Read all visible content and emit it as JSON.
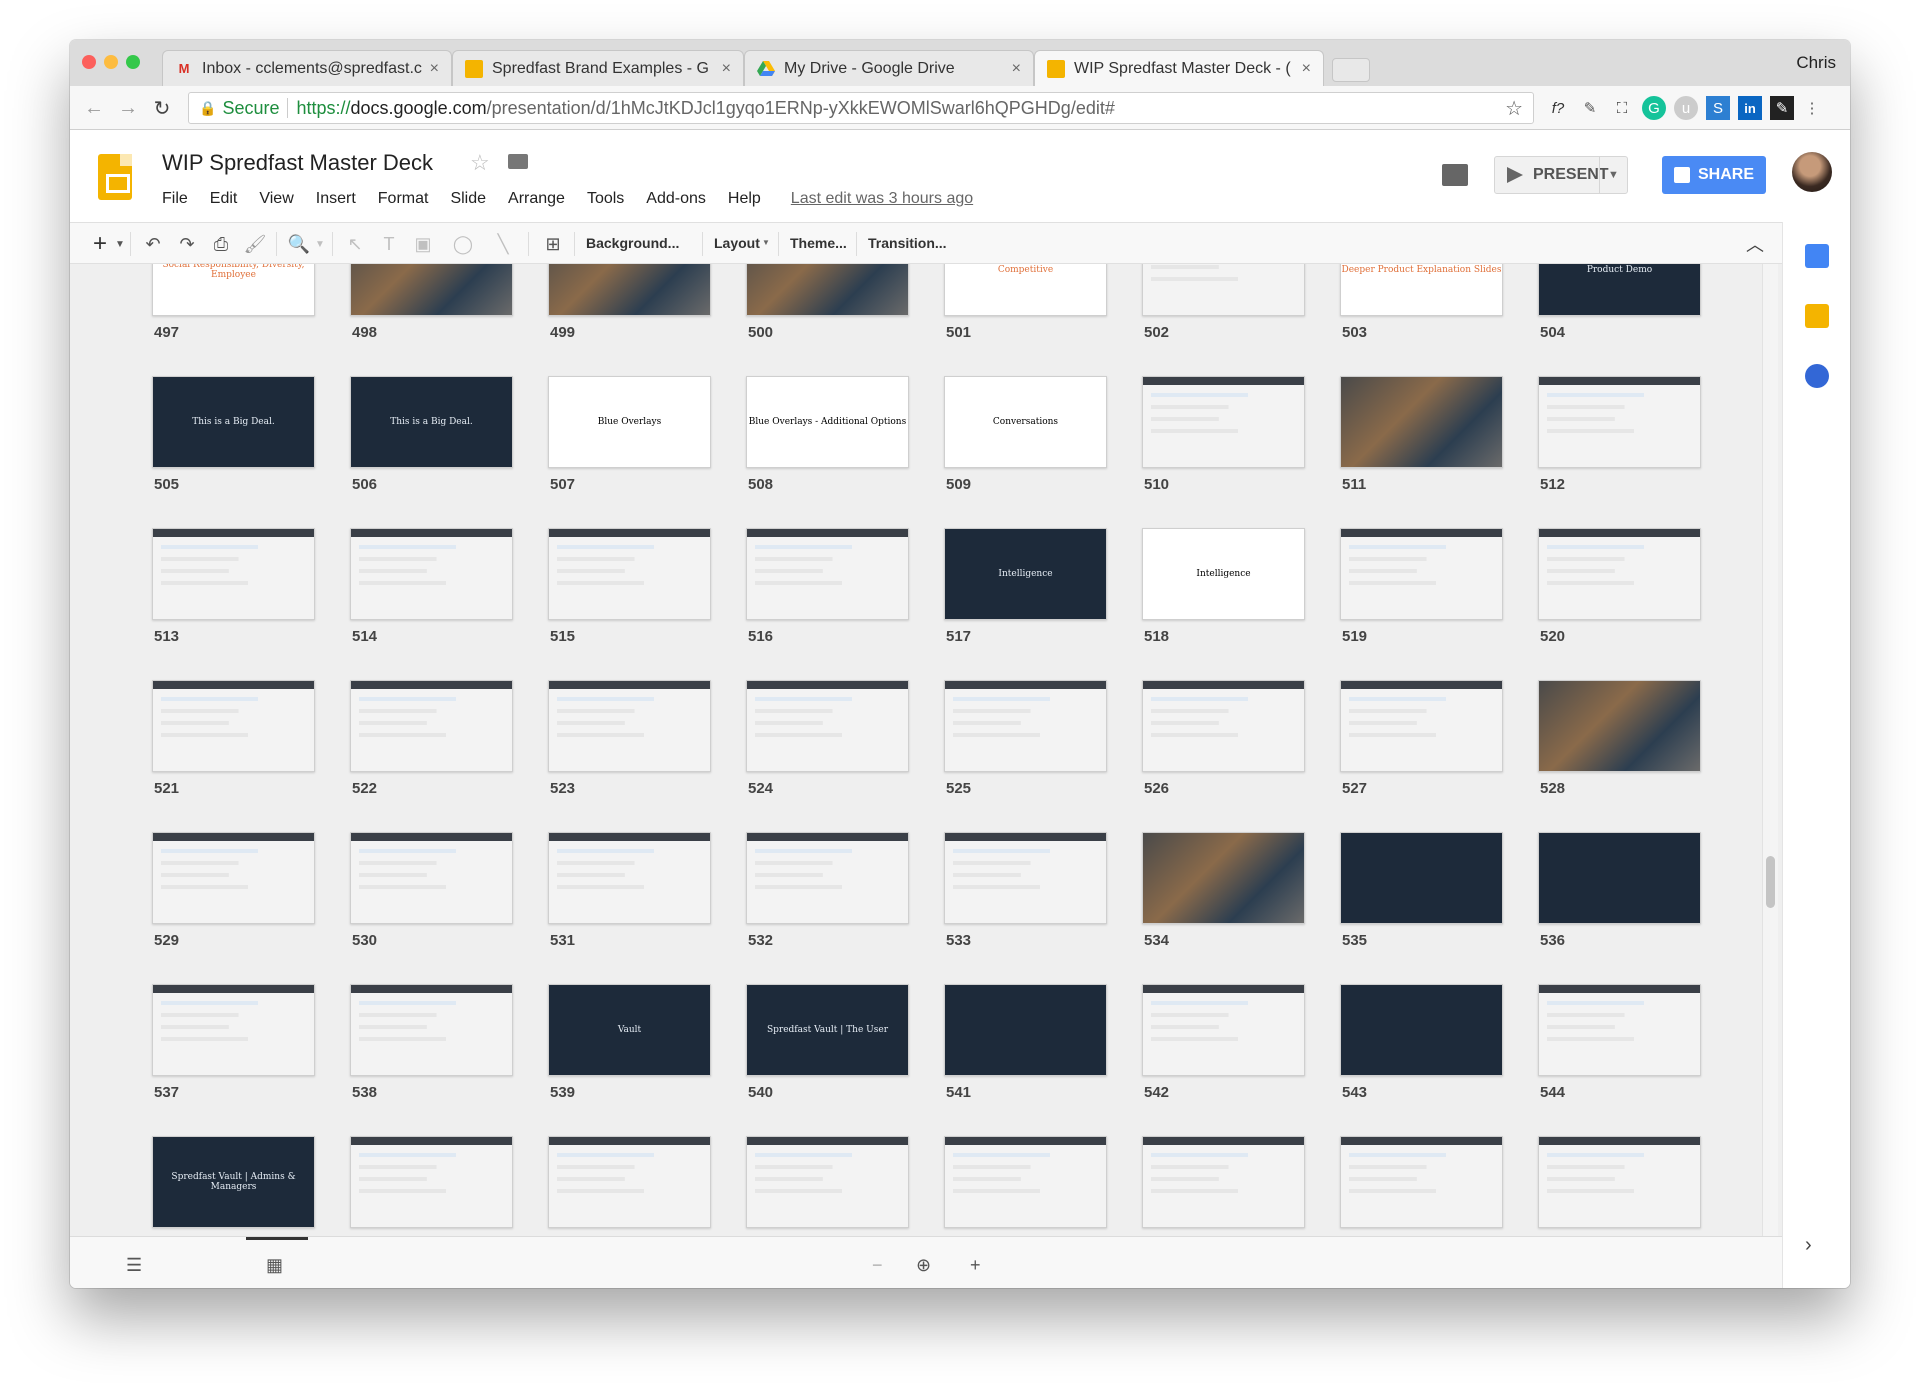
{
  "browser": {
    "profile_name": "Chris",
    "tabs": [
      {
        "label": "Inbox - cclements@spredfast.c",
        "icon": "gmail-icon"
      },
      {
        "label": "Spredfast Brand Examples - G",
        "icon": "slides-icon"
      },
      {
        "label": "My Drive - Google Drive",
        "icon": "drive-icon"
      },
      {
        "label": "WIP Spredfast Master Deck - (",
        "icon": "slides-icon"
      }
    ],
    "secure_label": "Secure",
    "url_scheme": "https://",
    "url_host": "docs.google.com",
    "url_path": "/presentation/d/1hMcJtKDJcl1gyqo1ERNp-yXkkEWOMlSwarl6hQPGHDg/edit#"
  },
  "doc": {
    "title": "WIP Spredfast Master Deck",
    "menu": [
      "File",
      "Edit",
      "View",
      "Insert",
      "Format",
      "Slide",
      "Arrange",
      "Tools",
      "Add-ons",
      "Help"
    ],
    "last_edit": "Last edit was 3 hours ago",
    "present_label": "PRESENT",
    "share_label": "SHARE"
  },
  "toolbar": {
    "background": "Background...",
    "layout": "Layout",
    "theme": "Theme...",
    "transition": "Transition..."
  },
  "slides": [
    {
      "num": "497",
      "style": "light",
      "text": "Social Responsibility, Diversity, Employee"
    },
    {
      "num": "498",
      "style": "photo",
      "text": ""
    },
    {
      "num": "499",
      "style": "photo",
      "text": ""
    },
    {
      "num": "500",
      "style": "photo",
      "text": ""
    },
    {
      "num": "501",
      "style": "light",
      "text": "Competitive"
    },
    {
      "num": "502",
      "style": "ui",
      "text": ""
    },
    {
      "num": "503",
      "style": "light",
      "text": "Deeper Product Explanation Slides"
    },
    {
      "num": "504",
      "style": "dark",
      "text": "Product Demo"
    },
    {
      "num": "505",
      "style": "dark",
      "text": "This is a Big Deal."
    },
    {
      "num": "506",
      "style": "dark",
      "text": "This is a Big Deal."
    },
    {
      "num": "507",
      "style": "plain",
      "text": "Blue Overlays"
    },
    {
      "num": "508",
      "style": "plain",
      "text": "Blue Overlays - Additional Options"
    },
    {
      "num": "509",
      "style": "plain",
      "text": "Conversations"
    },
    {
      "num": "510",
      "style": "ui",
      "text": ""
    },
    {
      "num": "511",
      "style": "photo",
      "text": ""
    },
    {
      "num": "512",
      "style": "ui",
      "text": ""
    },
    {
      "num": "513",
      "style": "ui",
      "text": ""
    },
    {
      "num": "514",
      "style": "ui",
      "text": ""
    },
    {
      "num": "515",
      "style": "ui",
      "text": ""
    },
    {
      "num": "516",
      "style": "ui",
      "text": ""
    },
    {
      "num": "517",
      "style": "dark",
      "text": "Intelligence"
    },
    {
      "num": "518",
      "style": "plain",
      "text": "Intelligence"
    },
    {
      "num": "519",
      "style": "ui",
      "text": ""
    },
    {
      "num": "520",
      "style": "ui",
      "text": ""
    },
    {
      "num": "521",
      "style": "ui",
      "text": ""
    },
    {
      "num": "522",
      "style": "ui",
      "text": ""
    },
    {
      "num": "523",
      "style": "ui",
      "text": ""
    },
    {
      "num": "524",
      "style": "ui",
      "text": ""
    },
    {
      "num": "525",
      "style": "ui",
      "text": ""
    },
    {
      "num": "526",
      "style": "ui",
      "text": ""
    },
    {
      "num": "527",
      "style": "ui",
      "text": ""
    },
    {
      "num": "528",
      "style": "photo",
      "text": ""
    },
    {
      "num": "529",
      "style": "ui",
      "text": ""
    },
    {
      "num": "530",
      "style": "ui",
      "text": ""
    },
    {
      "num": "531",
      "style": "ui",
      "text": ""
    },
    {
      "num": "532",
      "style": "ui",
      "text": ""
    },
    {
      "num": "533",
      "style": "ui",
      "text": ""
    },
    {
      "num": "534",
      "style": "photo",
      "text": ""
    },
    {
      "num": "535",
      "style": "dark",
      "text": ""
    },
    {
      "num": "536",
      "style": "dark",
      "text": ""
    },
    {
      "num": "537",
      "style": "ui",
      "text": ""
    },
    {
      "num": "538",
      "style": "ui",
      "text": ""
    },
    {
      "num": "539",
      "style": "dark",
      "text": "Vault"
    },
    {
      "num": "540",
      "style": "dark",
      "text": "Spredfast Vault | The User"
    },
    {
      "num": "541",
      "style": "dark",
      "text": ""
    },
    {
      "num": "542",
      "style": "ui",
      "text": ""
    },
    {
      "num": "543",
      "style": "dark",
      "text": ""
    },
    {
      "num": "544",
      "style": "ui",
      "text": ""
    },
    {
      "num": "",
      "style": "dark",
      "text": "Spredfast Vault | Admins & Managers"
    },
    {
      "num": "",
      "style": "ui",
      "text": ""
    },
    {
      "num": "",
      "style": "ui",
      "text": ""
    },
    {
      "num": "",
      "style": "ui",
      "text": ""
    },
    {
      "num": "",
      "style": "ui",
      "text": ""
    },
    {
      "num": "",
      "style": "ui",
      "text": ""
    },
    {
      "num": "",
      "style": "ui",
      "text": ""
    },
    {
      "num": "",
      "style": "ui",
      "text": ""
    }
  ]
}
